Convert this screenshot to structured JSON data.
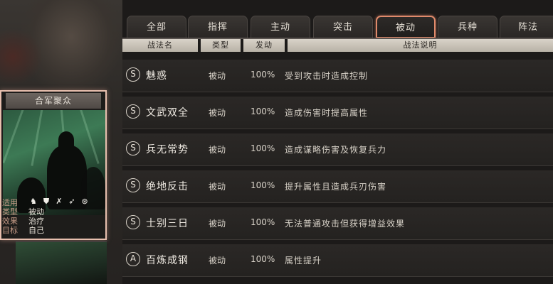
{
  "tabs": [
    {
      "label": "全部",
      "active": false
    },
    {
      "label": "指挥",
      "active": false
    },
    {
      "label": "主动",
      "active": false
    },
    {
      "label": "突击",
      "active": false
    },
    {
      "label": "被动",
      "active": true
    },
    {
      "label": "兵种",
      "active": false
    },
    {
      "label": "阵法",
      "active": false
    }
  ],
  "headers": {
    "name": "战法名",
    "type": "类型",
    "trigger": "发动",
    "description": "战法说明"
  },
  "skills": [
    {
      "grade": "S",
      "name": "魅惑",
      "type": "被动",
      "rate": "100%",
      "description": "受到攻击时造成控制"
    },
    {
      "grade": "S",
      "name": "文武双全",
      "type": "被动",
      "rate": "100%",
      "description": "造成伤害时提高属性"
    },
    {
      "grade": "S",
      "name": "兵无常势",
      "type": "被动",
      "rate": "100%",
      "description": "造成谋略伤害及恢复兵力"
    },
    {
      "grade": "S",
      "name": "绝地反击",
      "type": "被动",
      "rate": "100%",
      "description": "提升属性且造成兵刃伤害"
    },
    {
      "grade": "S",
      "name": "士别三日",
      "type": "被动",
      "rate": "100%",
      "description": "无法普通攻击但获得增益效果"
    },
    {
      "grade": "A",
      "name": "百炼成钢",
      "type": "被动",
      "rate": "100%",
      "description": "属性提升"
    }
  ],
  "card": {
    "title": "合军聚众",
    "icons": [
      "cavalry-icon",
      "shield-icon",
      "bow-icon",
      "spear-icon",
      "wheel-icon"
    ],
    "icon_glyphs": [
      "♞",
      "⛊",
      "✗",
      "➶",
      "⊛"
    ],
    "rows": [
      {
        "key": "适用",
        "value": ""
      },
      {
        "key": "类型",
        "value": "被动"
      },
      {
        "key": "效果",
        "value": "治疗"
      },
      {
        "key": "目标",
        "value": "自己"
      }
    ]
  },
  "colors": {
    "active_tab_border": "#e08a6b",
    "card_border": "#e7bfae",
    "info_key": "#c49a86"
  }
}
